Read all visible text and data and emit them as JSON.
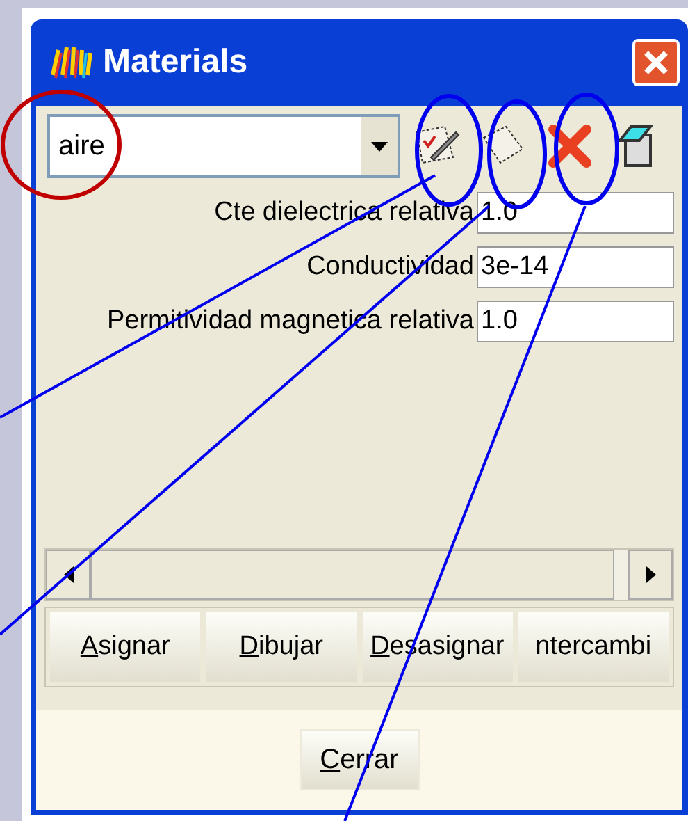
{
  "window": {
    "title": "Materials"
  },
  "material_select": {
    "value": "aire"
  },
  "toolbar": [
    {
      "kind": "edit"
    },
    {
      "kind": "new"
    },
    {
      "kind": "delete"
    },
    {
      "kind": "copy"
    }
  ],
  "properties": [
    {
      "label": "Cte dielectrica relativa",
      "value": "1.0"
    },
    {
      "label": "Conductividad",
      "value": "3e-14"
    },
    {
      "label": "Permitividad magnetica relativa",
      "value": "1.0"
    }
  ],
  "actions": [
    {
      "label": "Asignar",
      "underline_first": true
    },
    {
      "label": "Dibujar",
      "underline_first": true
    },
    {
      "label": "Desasignar",
      "underline_first": true
    },
    {
      "label": "ntercambi",
      "underline_first": false
    }
  ],
  "close_button": {
    "label": "Cerrar",
    "underline_first": true
  }
}
